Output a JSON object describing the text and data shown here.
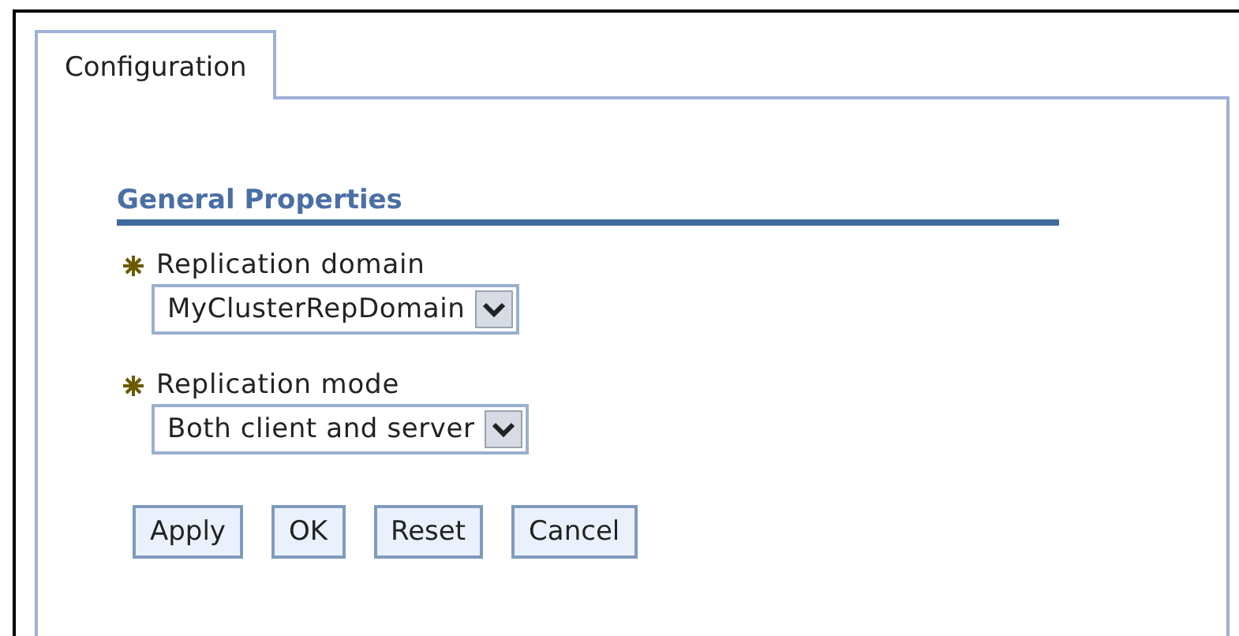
{
  "tabs": [
    {
      "label": "Configuration",
      "selected": true
    }
  ],
  "section": {
    "title": "General Properties"
  },
  "fields": [
    {
      "label": "Replication domain",
      "required": true,
      "value": "MyClusterRepDomain"
    },
    {
      "label": "Replication mode",
      "required": true,
      "value": "Both client and server"
    }
  ],
  "buttons": [
    "Apply",
    "OK",
    "Reset",
    "Cancel"
  ]
}
